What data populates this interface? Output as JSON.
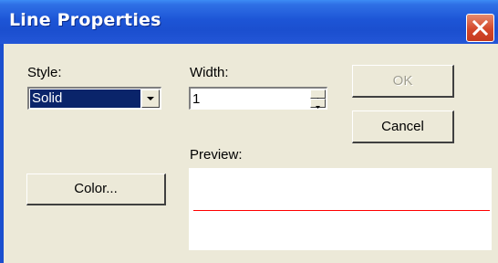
{
  "window": {
    "title": "Line Properties",
    "close_label": "close"
  },
  "style": {
    "label": "Style:",
    "value": "Solid"
  },
  "width": {
    "label": "Width:",
    "value": "1"
  },
  "buttons": {
    "ok": "OK",
    "cancel": "Cancel",
    "color": "Color..."
  },
  "preview": {
    "label": "Preview:",
    "line_color": "#ff0000"
  },
  "colors": {
    "title_bar": "#1d55d6",
    "face": "#ece9d8",
    "close": "#d4482a",
    "selection": "#0a246a"
  }
}
